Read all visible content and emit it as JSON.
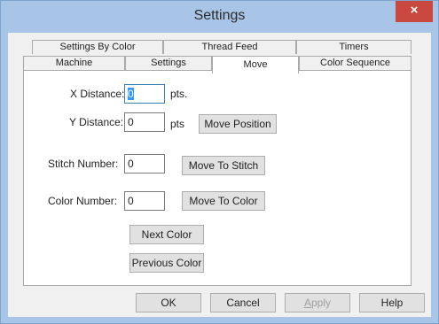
{
  "window": {
    "title": "Settings",
    "close_glyph": "×"
  },
  "tabs": {
    "back_row": [
      "Settings By Color",
      "Thread Feed",
      "Timers"
    ],
    "front_row": [
      "Machine",
      "Settings",
      "Move",
      "Color Sequence"
    ],
    "active": "Move"
  },
  "move": {
    "x_distance": {
      "label": "X Distance:",
      "value": "0",
      "unit": "pts."
    },
    "y_distance": {
      "label": "Y Distance:",
      "value": "0",
      "unit": "pts"
    },
    "move_position_label": "Move Position",
    "stitch_number": {
      "label": "Stitch Number:",
      "value": "0"
    },
    "move_to_stitch_label": "Move To Stitch",
    "color_number": {
      "label": "Color Number:",
      "value": "0"
    },
    "move_to_color_label": "Move To Color",
    "next_color_label": "Next Color",
    "previous_color_label": "Previous Color"
  },
  "footer": {
    "ok_label": "OK",
    "cancel_label": "Cancel",
    "apply_accel": "A",
    "apply_rest": "pply",
    "help_label": "Help"
  },
  "colors": {
    "frame": "#a8c4e6",
    "close_button": "#c9483f",
    "selection": "#3399ff"
  }
}
